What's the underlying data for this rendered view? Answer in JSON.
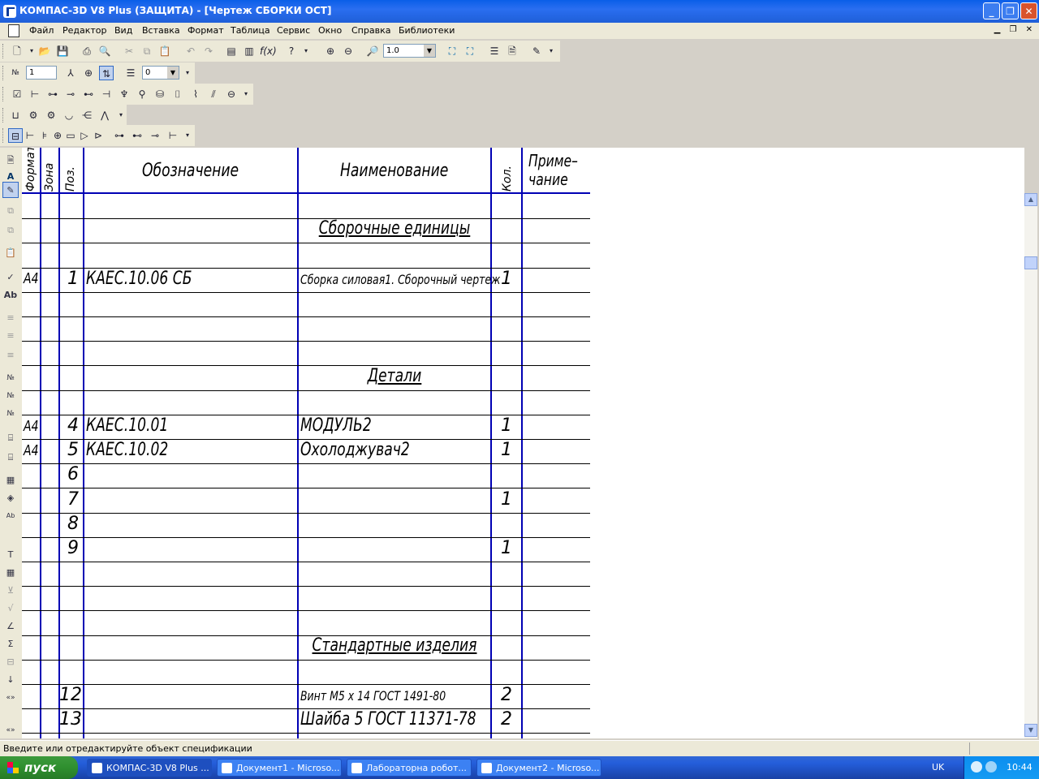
{
  "window": {
    "title": "КОМПАС-3D V8 Plus (ЗАЩИТА) - [Чертеж СБОРКИ ОСТ]"
  },
  "menu": [
    "Файл",
    "Редактор",
    "Вид",
    "Вставка",
    "Формат",
    "Таблица",
    "Сервис",
    "Окно",
    "Справка",
    "Библиотеки"
  ],
  "toolbar": {
    "zoom_value": "1.0",
    "sheet_value": "1",
    "style_value": "0"
  },
  "table": {
    "headers": {
      "format": "Формат",
      "zone": "Зона",
      "pos": "Поз.",
      "designation": "Обозначение",
      "name": "Наименование",
      "qty": "Кол.",
      "note_line1": "Приме–",
      "note_line2": "чание"
    },
    "rows": [
      {
        "format": "",
        "zone": "",
        "pos": "",
        "designation": "",
        "name": "",
        "qty": "",
        "section": ""
      },
      {
        "format": "",
        "zone": "",
        "pos": "",
        "designation": "",
        "name": "",
        "qty": "",
        "section": "Сборочные единицы"
      },
      {
        "format": "",
        "zone": "",
        "pos": "",
        "designation": "",
        "name": "",
        "qty": "",
        "section": ""
      },
      {
        "format": "А4",
        "zone": "",
        "pos": "1",
        "designation": "КАЕС.10.06 СБ",
        "name": "Сборка силовая1. Сборочный чертеж",
        "qty": "1",
        "section": ""
      },
      {
        "format": "",
        "zone": "",
        "pos": "",
        "designation": "",
        "name": "",
        "qty": "",
        "section": ""
      },
      {
        "format": "",
        "zone": "",
        "pos": "",
        "designation": "",
        "name": "",
        "qty": "",
        "section": ""
      },
      {
        "format": "",
        "zone": "",
        "pos": "",
        "designation": "",
        "name": "",
        "qty": "",
        "section": ""
      },
      {
        "format": "",
        "zone": "",
        "pos": "",
        "designation": "",
        "name": "",
        "qty": "",
        "section": "Детали"
      },
      {
        "format": "",
        "zone": "",
        "pos": "",
        "designation": "",
        "name": "",
        "qty": "",
        "section": ""
      },
      {
        "format": "А4",
        "zone": "",
        "pos": "4",
        "designation": "КАЕС.10.01",
        "name": "МОДУЛЬ2",
        "qty": "1",
        "section": ""
      },
      {
        "format": "А4",
        "zone": "",
        "pos": "5",
        "designation": "КАЕС.10.02",
        "name": "Охолоджувач2",
        "qty": "1",
        "section": ""
      },
      {
        "format": "",
        "zone": "",
        "pos": "6",
        "designation": "",
        "name": "",
        "qty": "",
        "section": ""
      },
      {
        "format": "",
        "zone": "",
        "pos": "7",
        "designation": "",
        "name": "",
        "qty": "1",
        "section": ""
      },
      {
        "format": "",
        "zone": "",
        "pos": "8",
        "designation": "",
        "name": "",
        "qty": "",
        "section": ""
      },
      {
        "format": "",
        "zone": "",
        "pos": "9",
        "designation": "",
        "name": "",
        "qty": "1",
        "section": ""
      },
      {
        "format": "",
        "zone": "",
        "pos": "",
        "designation": "",
        "name": "",
        "qty": "",
        "section": ""
      },
      {
        "format": "",
        "zone": "",
        "pos": "",
        "designation": "",
        "name": "",
        "qty": "",
        "section": ""
      },
      {
        "format": "",
        "zone": "",
        "pos": "",
        "designation": "",
        "name": "",
        "qty": "",
        "section": ""
      },
      {
        "format": "",
        "zone": "",
        "pos": "",
        "designation": "",
        "name": "",
        "qty": "",
        "section": "Стандартные изделия"
      },
      {
        "format": "",
        "zone": "",
        "pos": "",
        "designation": "",
        "name": "",
        "qty": "",
        "section": ""
      },
      {
        "format": "",
        "zone": "",
        "pos": "12",
        "designation": "",
        "name": "Винт М5 х 14 ГОСТ 1491-80",
        "qty": "2",
        "section": ""
      },
      {
        "format": "",
        "zone": "",
        "pos": "13",
        "designation": "",
        "name": "Шайба 5 ГОСТ 11371-78",
        "qty": "2",
        "section": ""
      },
      {
        "format": "",
        "zone": "",
        "pos": "",
        "designation": "",
        "name": "",
        "qty": "",
        "section": ""
      }
    ]
  },
  "status": {
    "text": "Введите или отредактируйте объект спецификации"
  },
  "taskbar": {
    "start_label": "пуск",
    "tasks": [
      "КОМПАС-3D V8 Plus ...",
      "Документ1 - Microso...",
      "Лабораторна  робот...",
      "Документ2 - Microso..."
    ],
    "lang": "UK",
    "clock": "10:44"
  },
  "colors": {
    "grid_blue": "#0000b4",
    "titlebar": "#0a5ee8"
  }
}
